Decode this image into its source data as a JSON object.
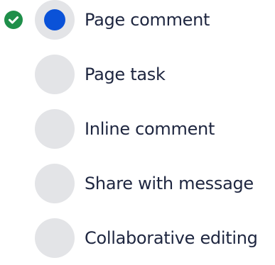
{
  "colors": {
    "selected_dot": "#0a52d8",
    "check_badge": "#1f8f4a",
    "radio_background": "#e3e4e7",
    "label_text": "#1e2640"
  },
  "options": [
    {
      "label": "Page comment",
      "selected": true,
      "icon": "check-circle-icon"
    },
    {
      "label": "Page task",
      "selected": false
    },
    {
      "label": "Inline comment",
      "selected": false
    },
    {
      "label": "Share with message",
      "selected": false
    },
    {
      "label": "Collaborative editing",
      "selected": false
    }
  ]
}
